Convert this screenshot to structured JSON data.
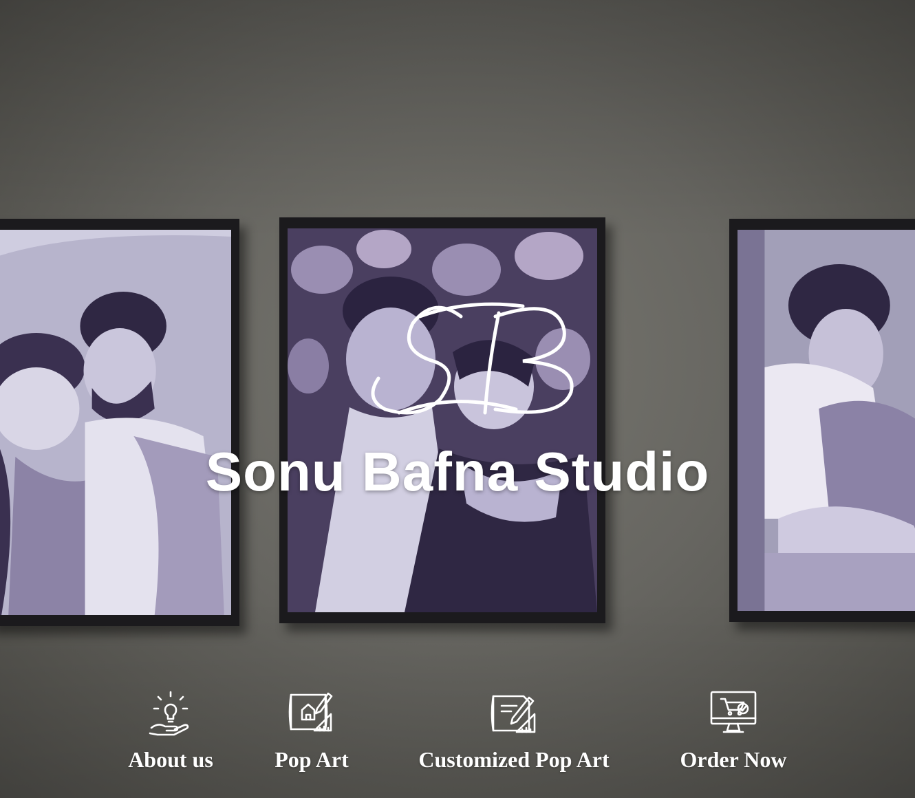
{
  "hero": {
    "monogram": "SB",
    "title": "Sonu Bafna Studio"
  },
  "gallery": {
    "frames": [
      {
        "name": "left-portrait"
      },
      {
        "name": "center-portrait"
      },
      {
        "name": "right-portrait"
      }
    ]
  },
  "nav": {
    "items": [
      {
        "label": "About us",
        "icon": "lightbulb-hand-icon"
      },
      {
        "label": "Pop Art",
        "icon": "blueprint-icon"
      },
      {
        "label": "Customized Pop Art",
        "icon": "drafting-tools-icon"
      },
      {
        "label": "Order Now",
        "icon": "monitor-cart-icon"
      }
    ]
  },
  "colors": {
    "wall": "#676661",
    "frame": "#1b1a1d",
    "art_light": "#b9b6cf",
    "art_mid": "#7d7396",
    "art_dark": "#3b3150",
    "text": "#ffffff"
  }
}
